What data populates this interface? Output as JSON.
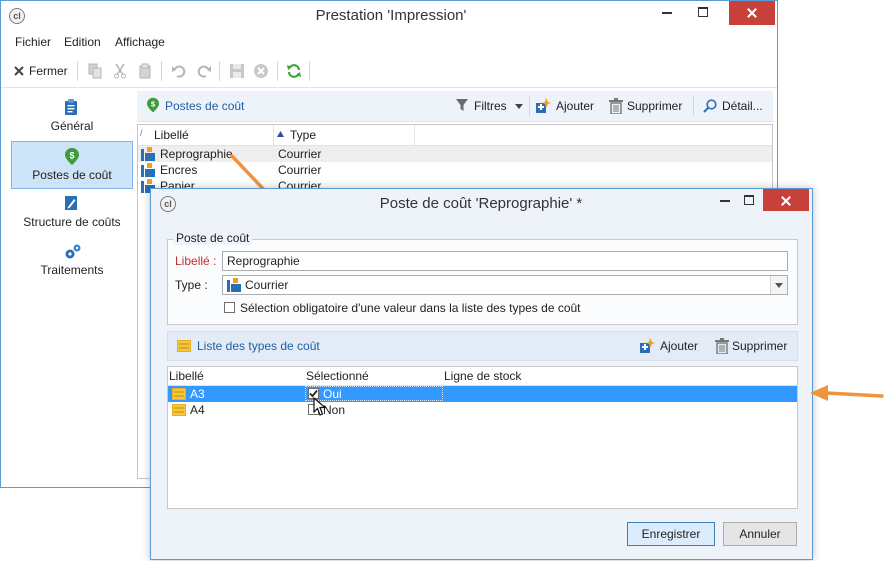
{
  "main_window": {
    "logo": "cl",
    "title": "Prestation 'Impression'",
    "menu": [
      "Fichier",
      "Edition",
      "Affichage"
    ],
    "toolbar": {
      "close_label": "Fermer"
    },
    "sidebar": [
      {
        "label": "Général",
        "icon": "clipboard-icon"
      },
      {
        "label": "Postes de coût",
        "icon": "money-pin-icon",
        "active": true
      },
      {
        "label": "Structure de coûts",
        "icon": "pencil-icon"
      },
      {
        "label": "Traitements",
        "icon": "gears-icon"
      }
    ],
    "section": {
      "title": "Postes de coût",
      "filters_label": "Filtres",
      "add_label": "Ajouter",
      "delete_label": "Supprimer",
      "detail_label": "Détail..."
    },
    "grid": {
      "columns": [
        "Libellé",
        "Type"
      ],
      "rows": [
        {
          "libelle": "Reprographie",
          "type": "Courrier"
        },
        {
          "libelle": "Encres",
          "type": "Courrier"
        },
        {
          "libelle": "Papier",
          "type": "Courrier"
        }
      ]
    }
  },
  "dialog": {
    "logo": "cl",
    "title": "Poste de coût 'Reprographie' *",
    "group_title": "Poste de coût",
    "libelle_label": "Libellé :",
    "libelle_value": "Reprographie",
    "type_label": "Type :",
    "type_value": "Courrier",
    "mandatory_label": "Sélection obligatoire d'une valeur dans la liste des types de coût",
    "mandatory_checked": false,
    "list_title": "Liste des types de coût",
    "add_label": "Ajouter",
    "delete_label": "Supprimer",
    "grid": {
      "columns": [
        "Libellé",
        "Sélectionné",
        "Ligne de stock"
      ],
      "rows": [
        {
          "libelle": "A3",
          "selected_label": "Oui",
          "checked": true
        },
        {
          "libelle": "A4",
          "selected_label": "Non",
          "checked": false
        }
      ]
    },
    "save_label": "Enregistrer",
    "cancel_label": "Annuler"
  },
  "colors": {
    "accent": "#5b9bd5",
    "close_button": "#c7413a",
    "selection": "#3399ff",
    "arrow": "#f0943c",
    "required_label": "#c0302a"
  }
}
